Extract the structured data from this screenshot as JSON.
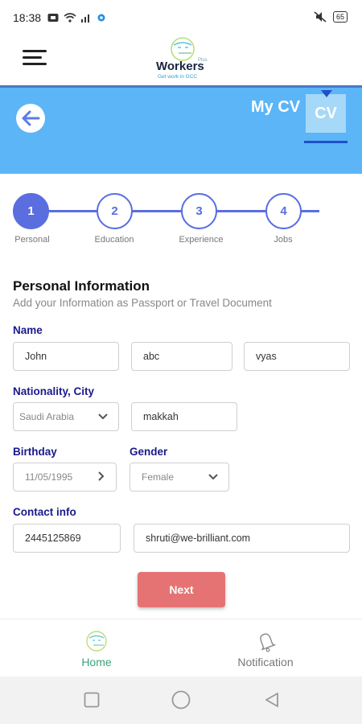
{
  "status_bar": {
    "time": "18:38",
    "battery": "65"
  },
  "header": {
    "logo_name": "Workers",
    "logo_plus": "Plus",
    "logo_tagline": "Get work in GCC"
  },
  "banner": {
    "title": "My CV",
    "cv_badge": "CV",
    "color": "#5bb5f7"
  },
  "stepper": {
    "steps": [
      {
        "number": "1",
        "label": "Personal",
        "active": true
      },
      {
        "number": "2",
        "label": "Education",
        "active": false
      },
      {
        "number": "3",
        "label": "Experience",
        "active": false
      },
      {
        "number": "4",
        "label": "Jobs",
        "active": false
      }
    ],
    "accent": "#5a6ee0"
  },
  "form": {
    "title": "Personal Information",
    "subtitle": "Add your Information as Passport or Travel Document",
    "name_label": "Name",
    "first_name": "John",
    "middle_name": "abc",
    "last_name": "vyas",
    "nationality_label": "Nationality, City",
    "nationality": "Saudi Arabia",
    "city": "makkah",
    "birthday_label": "Birthday",
    "birthday": "11/05/1995",
    "gender_label": "Gender",
    "gender": "Female",
    "contact_label": "Contact info",
    "phone": "2445125869",
    "email": "shruti@we-brilliant.com"
  },
  "next_button": {
    "label": "Next",
    "color": "#e67373"
  },
  "bottom_nav": {
    "home_label": "Home",
    "notification_label": "Notification",
    "home_color": "#3aa37a"
  }
}
